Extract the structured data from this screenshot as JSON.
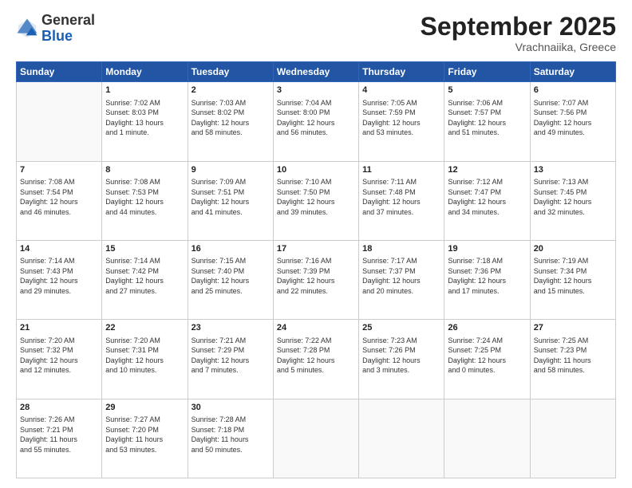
{
  "header": {
    "logo_line1": "General",
    "logo_line2": "Blue",
    "month": "September 2025",
    "location": "Vrachnaiika, Greece"
  },
  "weekdays": [
    "Sunday",
    "Monday",
    "Tuesday",
    "Wednesday",
    "Thursday",
    "Friday",
    "Saturday"
  ],
  "weeks": [
    [
      {
        "num": "",
        "info": ""
      },
      {
        "num": "1",
        "info": "Sunrise: 7:02 AM\nSunset: 8:03 PM\nDaylight: 13 hours\nand 1 minute."
      },
      {
        "num": "2",
        "info": "Sunrise: 7:03 AM\nSunset: 8:02 PM\nDaylight: 12 hours\nand 58 minutes."
      },
      {
        "num": "3",
        "info": "Sunrise: 7:04 AM\nSunset: 8:00 PM\nDaylight: 12 hours\nand 56 minutes."
      },
      {
        "num": "4",
        "info": "Sunrise: 7:05 AM\nSunset: 7:59 PM\nDaylight: 12 hours\nand 53 minutes."
      },
      {
        "num": "5",
        "info": "Sunrise: 7:06 AM\nSunset: 7:57 PM\nDaylight: 12 hours\nand 51 minutes."
      },
      {
        "num": "6",
        "info": "Sunrise: 7:07 AM\nSunset: 7:56 PM\nDaylight: 12 hours\nand 49 minutes."
      }
    ],
    [
      {
        "num": "7",
        "info": "Sunrise: 7:08 AM\nSunset: 7:54 PM\nDaylight: 12 hours\nand 46 minutes."
      },
      {
        "num": "8",
        "info": "Sunrise: 7:08 AM\nSunset: 7:53 PM\nDaylight: 12 hours\nand 44 minutes."
      },
      {
        "num": "9",
        "info": "Sunrise: 7:09 AM\nSunset: 7:51 PM\nDaylight: 12 hours\nand 41 minutes."
      },
      {
        "num": "10",
        "info": "Sunrise: 7:10 AM\nSunset: 7:50 PM\nDaylight: 12 hours\nand 39 minutes."
      },
      {
        "num": "11",
        "info": "Sunrise: 7:11 AM\nSunset: 7:48 PM\nDaylight: 12 hours\nand 37 minutes."
      },
      {
        "num": "12",
        "info": "Sunrise: 7:12 AM\nSunset: 7:47 PM\nDaylight: 12 hours\nand 34 minutes."
      },
      {
        "num": "13",
        "info": "Sunrise: 7:13 AM\nSunset: 7:45 PM\nDaylight: 12 hours\nand 32 minutes."
      }
    ],
    [
      {
        "num": "14",
        "info": "Sunrise: 7:14 AM\nSunset: 7:43 PM\nDaylight: 12 hours\nand 29 minutes."
      },
      {
        "num": "15",
        "info": "Sunrise: 7:14 AM\nSunset: 7:42 PM\nDaylight: 12 hours\nand 27 minutes."
      },
      {
        "num": "16",
        "info": "Sunrise: 7:15 AM\nSunset: 7:40 PM\nDaylight: 12 hours\nand 25 minutes."
      },
      {
        "num": "17",
        "info": "Sunrise: 7:16 AM\nSunset: 7:39 PM\nDaylight: 12 hours\nand 22 minutes."
      },
      {
        "num": "18",
        "info": "Sunrise: 7:17 AM\nSunset: 7:37 PM\nDaylight: 12 hours\nand 20 minutes."
      },
      {
        "num": "19",
        "info": "Sunrise: 7:18 AM\nSunset: 7:36 PM\nDaylight: 12 hours\nand 17 minutes."
      },
      {
        "num": "20",
        "info": "Sunrise: 7:19 AM\nSunset: 7:34 PM\nDaylight: 12 hours\nand 15 minutes."
      }
    ],
    [
      {
        "num": "21",
        "info": "Sunrise: 7:20 AM\nSunset: 7:32 PM\nDaylight: 12 hours\nand 12 minutes."
      },
      {
        "num": "22",
        "info": "Sunrise: 7:20 AM\nSunset: 7:31 PM\nDaylight: 12 hours\nand 10 minutes."
      },
      {
        "num": "23",
        "info": "Sunrise: 7:21 AM\nSunset: 7:29 PM\nDaylight: 12 hours\nand 7 minutes."
      },
      {
        "num": "24",
        "info": "Sunrise: 7:22 AM\nSunset: 7:28 PM\nDaylight: 12 hours\nand 5 minutes."
      },
      {
        "num": "25",
        "info": "Sunrise: 7:23 AM\nSunset: 7:26 PM\nDaylight: 12 hours\nand 3 minutes."
      },
      {
        "num": "26",
        "info": "Sunrise: 7:24 AM\nSunset: 7:25 PM\nDaylight: 12 hours\nand 0 minutes."
      },
      {
        "num": "27",
        "info": "Sunrise: 7:25 AM\nSunset: 7:23 PM\nDaylight: 11 hours\nand 58 minutes."
      }
    ],
    [
      {
        "num": "28",
        "info": "Sunrise: 7:26 AM\nSunset: 7:21 PM\nDaylight: 11 hours\nand 55 minutes."
      },
      {
        "num": "29",
        "info": "Sunrise: 7:27 AM\nSunset: 7:20 PM\nDaylight: 11 hours\nand 53 minutes."
      },
      {
        "num": "30",
        "info": "Sunrise: 7:28 AM\nSunset: 7:18 PM\nDaylight: 11 hours\nand 50 minutes."
      },
      {
        "num": "",
        "info": ""
      },
      {
        "num": "",
        "info": ""
      },
      {
        "num": "",
        "info": ""
      },
      {
        "num": "",
        "info": ""
      }
    ]
  ]
}
